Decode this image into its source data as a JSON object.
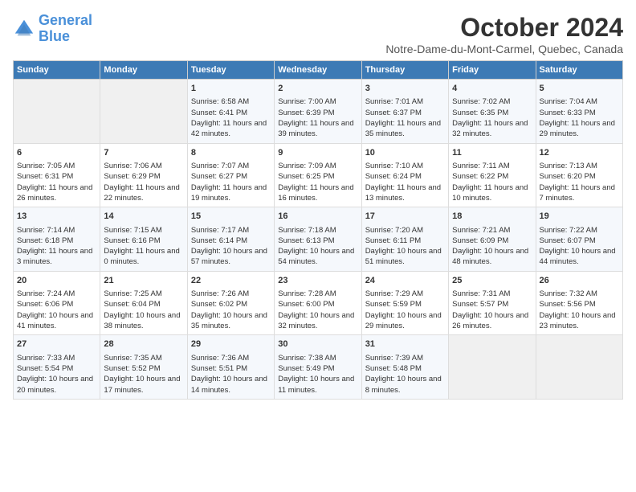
{
  "header": {
    "logo_line1": "General",
    "logo_line2": "Blue",
    "title": "October 2024",
    "location": "Notre-Dame-du-Mont-Carmel, Quebec, Canada"
  },
  "days_of_week": [
    "Sunday",
    "Monday",
    "Tuesday",
    "Wednesday",
    "Thursday",
    "Friday",
    "Saturday"
  ],
  "weeks": [
    [
      {
        "day": "",
        "info": ""
      },
      {
        "day": "",
        "info": ""
      },
      {
        "day": "1",
        "info": "Sunrise: 6:58 AM\nSunset: 6:41 PM\nDaylight: 11 hours and 42 minutes."
      },
      {
        "day": "2",
        "info": "Sunrise: 7:00 AM\nSunset: 6:39 PM\nDaylight: 11 hours and 39 minutes."
      },
      {
        "day": "3",
        "info": "Sunrise: 7:01 AM\nSunset: 6:37 PM\nDaylight: 11 hours and 35 minutes."
      },
      {
        "day": "4",
        "info": "Sunrise: 7:02 AM\nSunset: 6:35 PM\nDaylight: 11 hours and 32 minutes."
      },
      {
        "day": "5",
        "info": "Sunrise: 7:04 AM\nSunset: 6:33 PM\nDaylight: 11 hours and 29 minutes."
      }
    ],
    [
      {
        "day": "6",
        "info": "Sunrise: 7:05 AM\nSunset: 6:31 PM\nDaylight: 11 hours and 26 minutes."
      },
      {
        "day": "7",
        "info": "Sunrise: 7:06 AM\nSunset: 6:29 PM\nDaylight: 11 hours and 22 minutes."
      },
      {
        "day": "8",
        "info": "Sunrise: 7:07 AM\nSunset: 6:27 PM\nDaylight: 11 hours and 19 minutes."
      },
      {
        "day": "9",
        "info": "Sunrise: 7:09 AM\nSunset: 6:25 PM\nDaylight: 11 hours and 16 minutes."
      },
      {
        "day": "10",
        "info": "Sunrise: 7:10 AM\nSunset: 6:24 PM\nDaylight: 11 hours and 13 minutes."
      },
      {
        "day": "11",
        "info": "Sunrise: 7:11 AM\nSunset: 6:22 PM\nDaylight: 11 hours and 10 minutes."
      },
      {
        "day": "12",
        "info": "Sunrise: 7:13 AM\nSunset: 6:20 PM\nDaylight: 11 hours and 7 minutes."
      }
    ],
    [
      {
        "day": "13",
        "info": "Sunrise: 7:14 AM\nSunset: 6:18 PM\nDaylight: 11 hours and 3 minutes."
      },
      {
        "day": "14",
        "info": "Sunrise: 7:15 AM\nSunset: 6:16 PM\nDaylight: 11 hours and 0 minutes."
      },
      {
        "day": "15",
        "info": "Sunrise: 7:17 AM\nSunset: 6:14 PM\nDaylight: 10 hours and 57 minutes."
      },
      {
        "day": "16",
        "info": "Sunrise: 7:18 AM\nSunset: 6:13 PM\nDaylight: 10 hours and 54 minutes."
      },
      {
        "day": "17",
        "info": "Sunrise: 7:20 AM\nSunset: 6:11 PM\nDaylight: 10 hours and 51 minutes."
      },
      {
        "day": "18",
        "info": "Sunrise: 7:21 AM\nSunset: 6:09 PM\nDaylight: 10 hours and 48 minutes."
      },
      {
        "day": "19",
        "info": "Sunrise: 7:22 AM\nSunset: 6:07 PM\nDaylight: 10 hours and 44 minutes."
      }
    ],
    [
      {
        "day": "20",
        "info": "Sunrise: 7:24 AM\nSunset: 6:06 PM\nDaylight: 10 hours and 41 minutes."
      },
      {
        "day": "21",
        "info": "Sunrise: 7:25 AM\nSunset: 6:04 PM\nDaylight: 10 hours and 38 minutes."
      },
      {
        "day": "22",
        "info": "Sunrise: 7:26 AM\nSunset: 6:02 PM\nDaylight: 10 hours and 35 minutes."
      },
      {
        "day": "23",
        "info": "Sunrise: 7:28 AM\nSunset: 6:00 PM\nDaylight: 10 hours and 32 minutes."
      },
      {
        "day": "24",
        "info": "Sunrise: 7:29 AM\nSunset: 5:59 PM\nDaylight: 10 hours and 29 minutes."
      },
      {
        "day": "25",
        "info": "Sunrise: 7:31 AM\nSunset: 5:57 PM\nDaylight: 10 hours and 26 minutes."
      },
      {
        "day": "26",
        "info": "Sunrise: 7:32 AM\nSunset: 5:56 PM\nDaylight: 10 hours and 23 minutes."
      }
    ],
    [
      {
        "day": "27",
        "info": "Sunrise: 7:33 AM\nSunset: 5:54 PM\nDaylight: 10 hours and 20 minutes."
      },
      {
        "day": "28",
        "info": "Sunrise: 7:35 AM\nSunset: 5:52 PM\nDaylight: 10 hours and 17 minutes."
      },
      {
        "day": "29",
        "info": "Sunrise: 7:36 AM\nSunset: 5:51 PM\nDaylight: 10 hours and 14 minutes."
      },
      {
        "day": "30",
        "info": "Sunrise: 7:38 AM\nSunset: 5:49 PM\nDaylight: 10 hours and 11 minutes."
      },
      {
        "day": "31",
        "info": "Sunrise: 7:39 AM\nSunset: 5:48 PM\nDaylight: 10 hours and 8 minutes."
      },
      {
        "day": "",
        "info": ""
      },
      {
        "day": "",
        "info": ""
      }
    ]
  ]
}
